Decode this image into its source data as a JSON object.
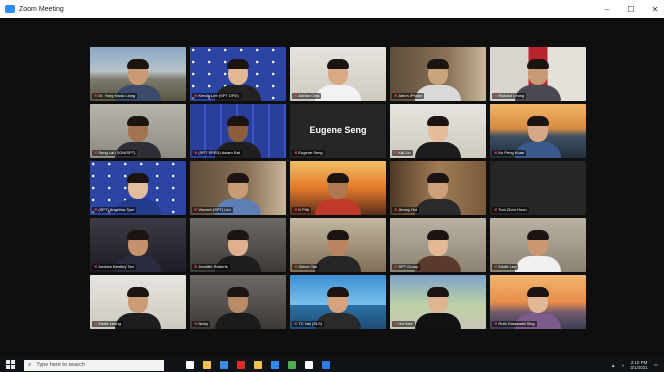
{
  "window": {
    "title": "Zoom Meeting",
    "controls": [
      "–",
      "☐",
      "✕"
    ]
  },
  "participants": [
    {
      "name": "Dr. Yong Kwok Liong",
      "bg": "bg-city",
      "skin": "#c99a74",
      "shirt": "#3a4a68"
    },
    {
      "name": "Kenda Lee (SPT DPD)",
      "bg": "bg-blue-dots",
      "skin": "#e0b896",
      "shirt": "#222"
    },
    {
      "name": "Adrian Chia",
      "bg": "bg-white",
      "skin": "#d8a982",
      "shirt": "#f2f2f2"
    },
    {
      "name": "Alex's iPhone",
      "bg": "bg-room",
      "skin": "#c9a57e",
      "shirt": "#d9d9d9"
    },
    {
      "name": "Richard Leong",
      "bg": "bg-red",
      "skin": "#c79a73",
      "shirt": "#4a4a52"
    },
    {
      "name": "Seng Lai (SGN/SPT)",
      "bg": "bg-office",
      "skin": "#a37250",
      "shirt": "#2e2e36"
    },
    {
      "name": "(SPT SPED) Aslam Rai",
      "bg": "bg-blue",
      "skin": "#8d5e3c",
      "shirt": "#1f1f1f"
    },
    {
      "name": "Eugene Seng",
      "bg": "bg-dark",
      "tile_text": "Eugene Seng"
    },
    {
      "name": "Kai Lin",
      "bg": "bg-white",
      "skin": "#e4bc99",
      "shirt": "#1d1d1d",
      "active": true
    },
    {
      "name": "Ku Peng Kuan",
      "bg": "bg-sunset",
      "skin": "#d6a887",
      "shirt": "#3a5a8c"
    },
    {
      "name": "(SPT) Angelina Sym",
      "bg": "bg-blue-dots",
      "skin": "#e3be9e",
      "shirt": "#243b8c"
    },
    {
      "name": "Vincent (SPT) Lim",
      "bg": "bg-room",
      "skin": "#c89c76",
      "shirt": "#5d7fb5"
    },
    {
      "name": "K Prib",
      "bg": "bg-fire",
      "skin": "#b07850",
      "shirt": "#c0392b"
    },
    {
      "name": "Jimmy Ooi",
      "bg": "bg-shelf",
      "skin": "#cfa07c",
      "shirt": "#2a2a2a"
    },
    {
      "name": "Toni Zhen Hoon",
      "bg": "bg-dark"
    },
    {
      "name": "Andrew Bentley Tan",
      "bg": "bg-chair",
      "skin": "#c3916b",
      "shirt": "#2b2b40"
    },
    {
      "name": "Jennifer Roberts",
      "bg": "bg-lab",
      "skin": "#e0b08e",
      "shirt": "#1e1e1e"
    },
    {
      "name": "Simon Tan",
      "bg": "bg-house",
      "skin": "#b98560",
      "shirt": "#262626"
    },
    {
      "name": "SPT Group",
      "bg": "bg-livingroom",
      "skin": "#e3b995",
      "shirt": "#5a3a2a"
    },
    {
      "name": "Eddie Lee",
      "bg": "bg-livingroom",
      "skin": "#c99870",
      "shirt": "#f0f0f0"
    },
    {
      "name": "Eddie Leong",
      "bg": "bg-white",
      "skin": "#c99b76",
      "shirt": "#1e1e1e"
    },
    {
      "name": "Nicky",
      "bg": "bg-lab",
      "skin": "#b98a66",
      "shirt": "#1b1b1b"
    },
    {
      "name": "TC Nai (SLS)",
      "bg": "bg-sea",
      "skin": "#d4a37e",
      "shirt": "#2a2a2a"
    },
    {
      "name": "Hui Kee",
      "bg": "bg-green",
      "skin": "#e0b592",
      "shirt": "#111"
    },
    {
      "name": "Ruth Saraswati Sing",
      "bg": "bg-bridge",
      "skin": "#e1b796",
      "shirt": "#7d5a8c"
    }
  ],
  "taskbar": {
    "search_placeholder": "Type here to search",
    "time": "3:10 PM",
    "date": "3/1/2021",
    "icon_colors": [
      "#ffffff",
      "#f2c14e",
      "#3a8ee6",
      "#d93025",
      "#f2c14e",
      "#2d8cff",
      "#4caf50",
      "#ffffff",
      "#2d7be5"
    ]
  }
}
